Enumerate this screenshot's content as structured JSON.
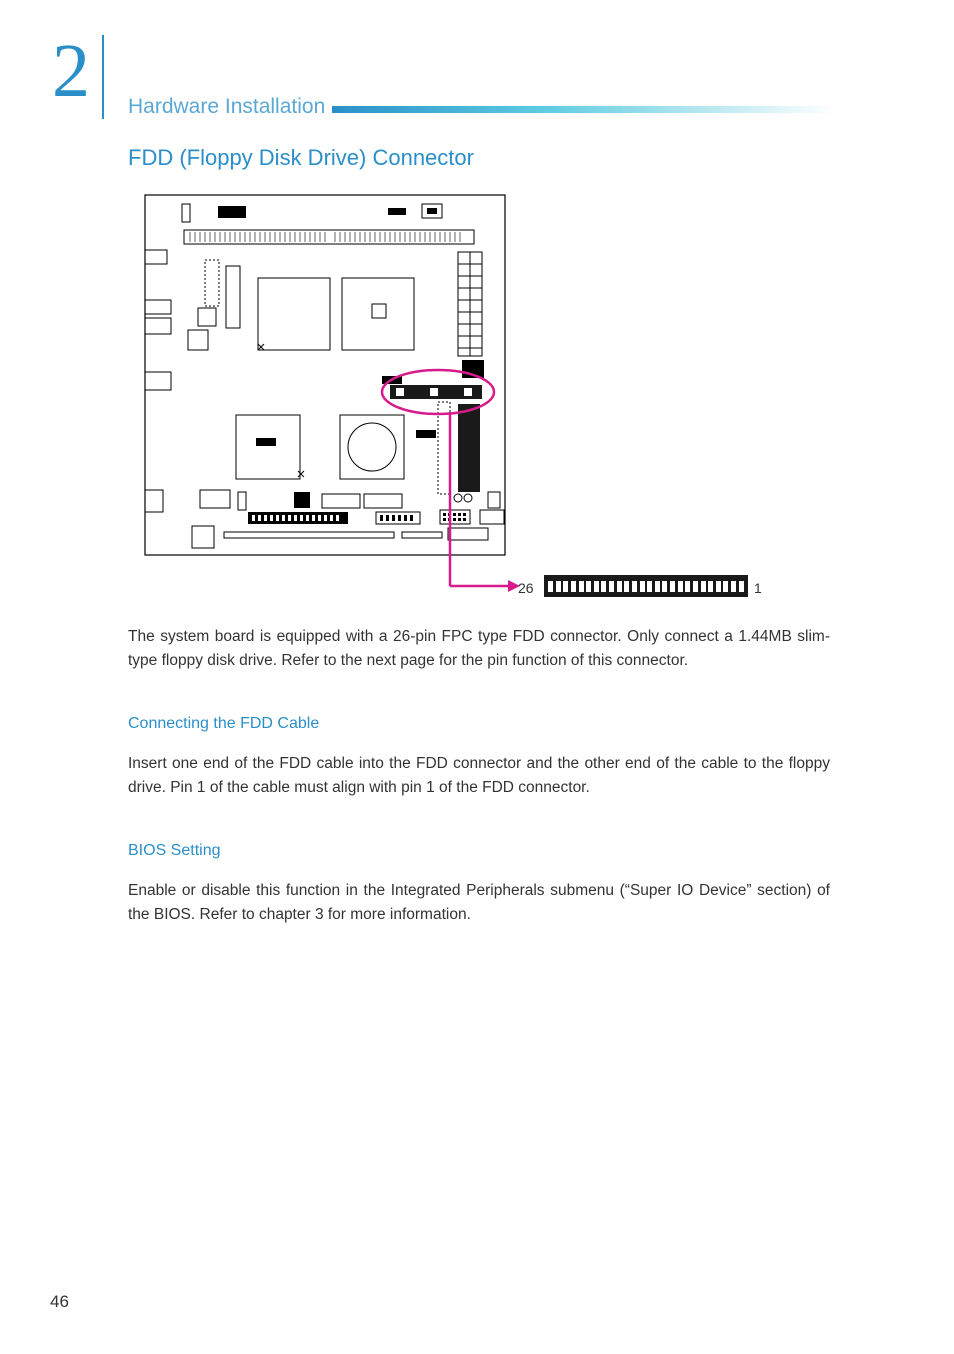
{
  "chapter": {
    "number": "2",
    "title": "Hardware Installation"
  },
  "section": {
    "title": "FDD (Floppy Disk Drive) Connector"
  },
  "diagram": {
    "pin_left": "26",
    "pin_right": "1"
  },
  "paragraphs": {
    "intro": "The system board is equipped with a 26-pin FPC type FDD connector. Only connect a 1.44MB slim-type floppy disk drive. Refer to the next page for the pin function of this connector.",
    "sub1_title": "Connecting the FDD Cable",
    "sub1_body": "Insert one end of the FDD cable into the FDD connector and the other end of the cable to the floppy drive. Pin 1 of the cable must align with pin 1 of the FDD connector.",
    "sub2_title": "BIOS Setting",
    "sub2_body": "Enable or disable this function in the Integrated Peripherals submenu (“Super IO Device” section) of the BIOS. Refer to chapter 3 for more information."
  },
  "page_number": "46"
}
